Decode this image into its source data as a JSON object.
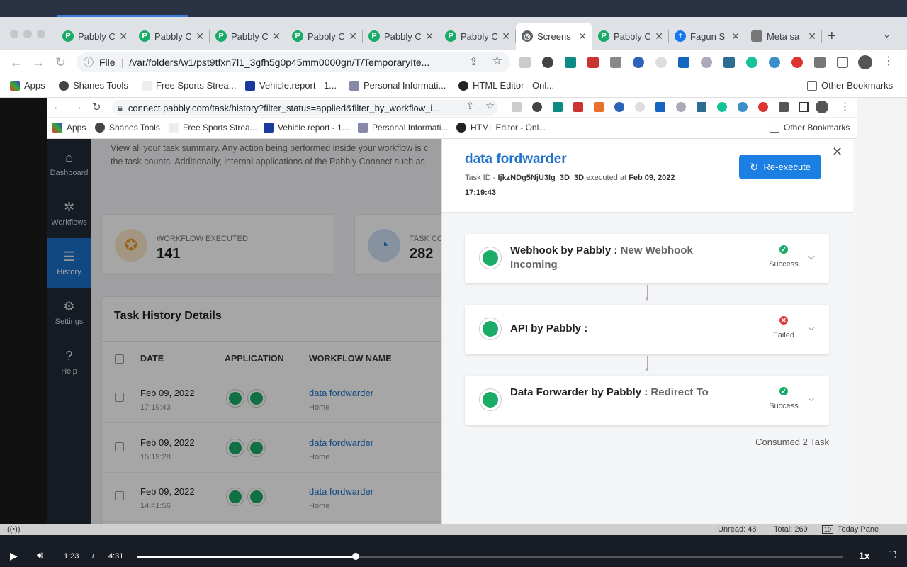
{
  "outer_browser": {
    "tabs": [
      {
        "label": "Pabbly C"
      },
      {
        "label": "Pabbly C"
      },
      {
        "label": "Pabbly C"
      },
      {
        "label": "Pabbly C"
      },
      {
        "label": "Pabbly C"
      },
      {
        "label": "Pabbly C"
      },
      {
        "label": "Screens",
        "active": true
      },
      {
        "label": "Pabbly C"
      },
      {
        "label": "Fagun S"
      },
      {
        "label": "Meta sa"
      }
    ],
    "url_prefix": "File",
    "url": "/var/folders/w1/pst9tfxn7l1_3gfh5g0p45mm0000gn/T/TemporaryIte...",
    "bookmarks": [
      "Apps",
      "Shanes Tools",
      "Free Sports Strea...",
      "Vehicle.report - 1...",
      "Personal Informati...",
      "HTML Editor - Onl..."
    ],
    "other_bookmarks": "Other Bookmarks"
  },
  "inner_browser": {
    "url": "connect.pabbly.com/task/history?filter_status=applied&filter_by_workflow_i...",
    "bookmarks": [
      "Apps",
      "Shanes Tools",
      "Free Sports Strea...",
      "Vehicle.report - 1...",
      "Personal Informati...",
      "HTML Editor - Onl..."
    ],
    "other_bookmarks": "Other Bookmarks"
  },
  "sidebar": {
    "items": [
      {
        "label": "Dashboard",
        "icon": "home-icon"
      },
      {
        "label": "Workflows",
        "icon": "gear-workflow-icon"
      },
      {
        "label": "History",
        "icon": "list-icon",
        "active": true
      },
      {
        "label": "Settings",
        "icon": "gear-icon"
      },
      {
        "label": "Help",
        "icon": "help-icon"
      }
    ]
  },
  "main": {
    "intro_line1": "View all your task summary. Any action being performed inside your workflow is c",
    "intro_line2": "the task counts. Additionally, internal applications of the Pabbly Connect such as",
    "stats": [
      {
        "label": "WORKFLOW EXECUTED",
        "value": "141"
      },
      {
        "label": "TASK CO",
        "value": "282"
      }
    ],
    "table_title": "Task History Details",
    "columns": [
      "DATE",
      "APPLICATION",
      "WORKFLOW NAME"
    ],
    "rows": [
      {
        "date": "Feb 09, 2022",
        "time": "17:19:43",
        "workflow": "data fordwarder",
        "folder": "Home"
      },
      {
        "date": "Feb 09, 2022",
        "time": "15:19:28",
        "workflow": "data fordwarder",
        "folder": "Home"
      },
      {
        "date": "Feb 09, 2022",
        "time": "14:41:56",
        "workflow": "data fordwarder",
        "folder": "Home"
      }
    ]
  },
  "panel": {
    "title": "data fordwarder",
    "task_id_label": "Task ID - ",
    "task_id": "IjkzNDg5NjU3Ig_3D_3D",
    "executed_label": " executed at ",
    "executed_at": "Feb 09, 2022",
    "executed_time": "17:19:43",
    "reexecute_label": "Re-execute",
    "steps": [
      {
        "app": "Webhook by Pabbly : ",
        "event": "New Webhook Incoming",
        "status": "Success"
      },
      {
        "app": "API by Pabbly : ",
        "event": "",
        "status": "Failed"
      },
      {
        "app": "Data Forwarder by Pabbly : ",
        "event": "Redirect To",
        "status": "Success"
      }
    ],
    "consumed": "Consumed 2 Task"
  },
  "mail_status": {
    "unread": "Unread: 48",
    "total": "Total: 269",
    "today": "Today Pane"
  },
  "video": {
    "current": "1:23",
    "separator": "/",
    "duration": "4:31",
    "progress": 0.31,
    "speed": "1x"
  },
  "colors": {
    "accent": "#1b7fe3",
    "success": "#1aab67",
    "failed": "#e0393e",
    "sidebar": "#1f2a36"
  }
}
